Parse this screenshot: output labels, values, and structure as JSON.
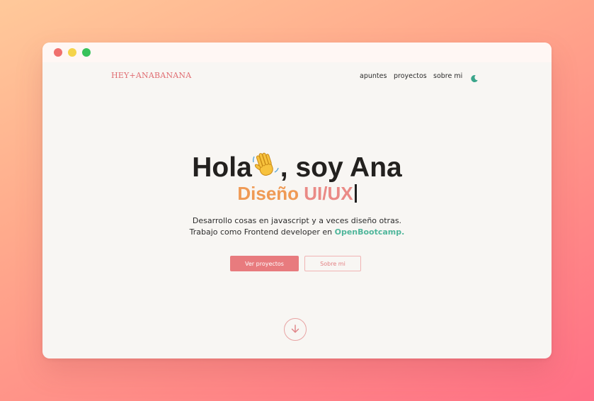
{
  "window": {
    "controls": [
      "close",
      "minimize",
      "maximize"
    ]
  },
  "header": {
    "brand": "HEY+ANABANANA",
    "nav": [
      {
        "label": "apuntes"
      },
      {
        "label": "proyectos"
      },
      {
        "label": "sobre mi"
      }
    ],
    "theme_toggle_icon": "moon-icon"
  },
  "hero": {
    "greeting_start": "Hola",
    "greeting_icon": "waving-hand-icon",
    "greeting_end": ", soy Ana",
    "role_part1": "Diseño",
    "role_part2": "UI/UX",
    "description_line1": "Desarrollo cosas en javascript y a veces diseño otras.",
    "description_line2_prefix": "Trabajo como Frontend developer en ",
    "description_link": "OpenBootcamp",
    "description_line2_suffix": ".",
    "primary_button": "Ver proyectos",
    "secondary_button": "Sobre mi",
    "scroll_icon": "arrow-down-icon"
  },
  "colors": {
    "brand": "#e06d72",
    "accent_orange": "#ef9a55",
    "accent_pink": "#ea8a86",
    "link_teal": "#4fb69b",
    "primary_button": "#e87b7e",
    "page_bg": "#f8f6f3"
  }
}
